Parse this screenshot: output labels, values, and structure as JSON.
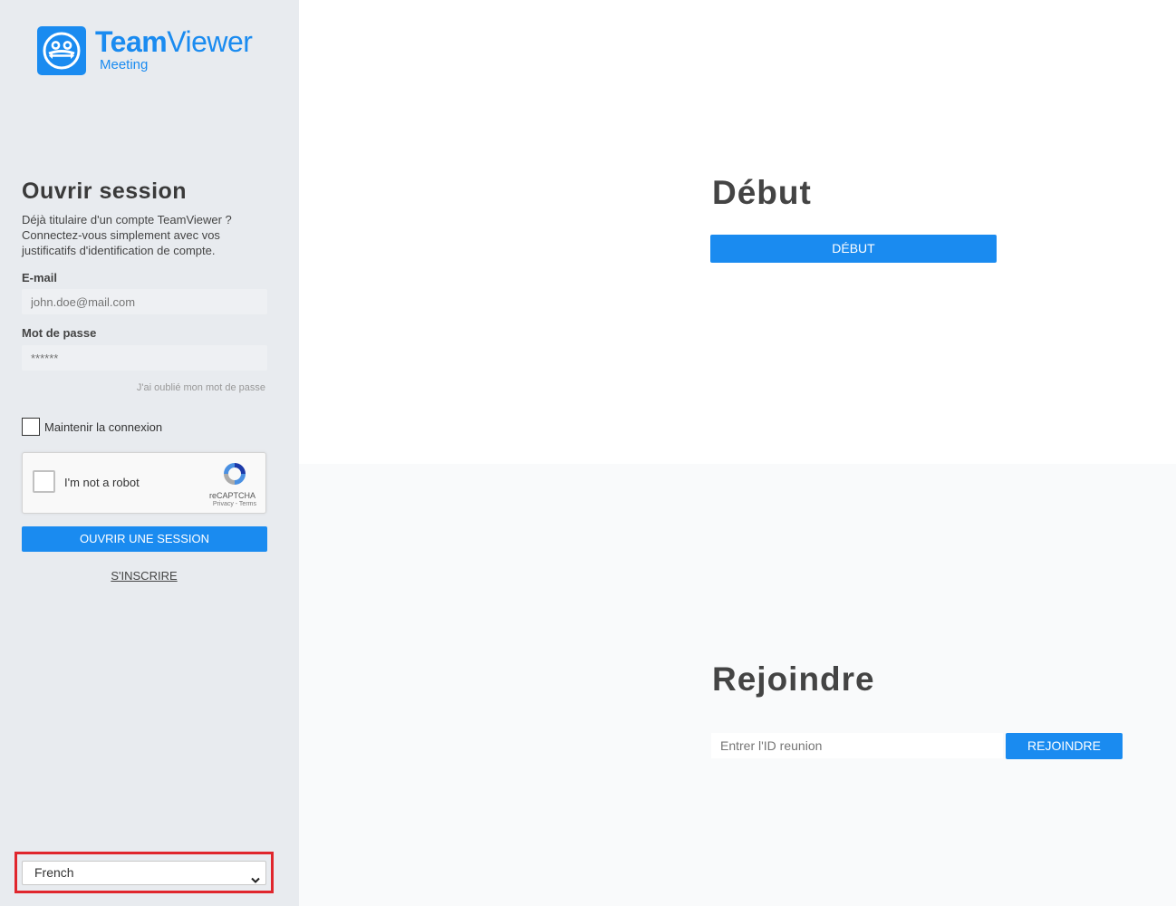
{
  "logo": {
    "brand_bold": "Team",
    "brand_light": "Viewer",
    "subtitle": "Meeting",
    "color": "#1a8bf0"
  },
  "login": {
    "title": "Ouvrir session",
    "description": "Déjà titulaire d'un compte TeamViewer ? Connectez-vous simplement avec vos justificatifs d'identification de compte.",
    "email_label": "E-mail",
    "email_placeholder": "john.doe@mail.com",
    "password_label": "Mot de passe",
    "password_placeholder": "******",
    "forgot_password": "J'ai oublié mon mot de passe",
    "keep_signed_in": "Maintenir la connexion",
    "captcha": {
      "label": "I'm not a robot",
      "brand": "reCAPTCHA",
      "terms": "Privacy - Terms"
    },
    "submit_label": "OUVRIR UNE SESSION",
    "signup_label": "S'INSCRIRE"
  },
  "language": {
    "selected": "French"
  },
  "start": {
    "title": "Début",
    "button_label": "DÉBUT"
  },
  "join": {
    "title": "Rejoindre",
    "input_placeholder": "Entrer l'ID reunion",
    "button_label": "REJOINDRE"
  },
  "colors": {
    "accent": "#1a8bf0",
    "highlight": "#e0262d",
    "sidebar_bg": "#e8ebef"
  }
}
